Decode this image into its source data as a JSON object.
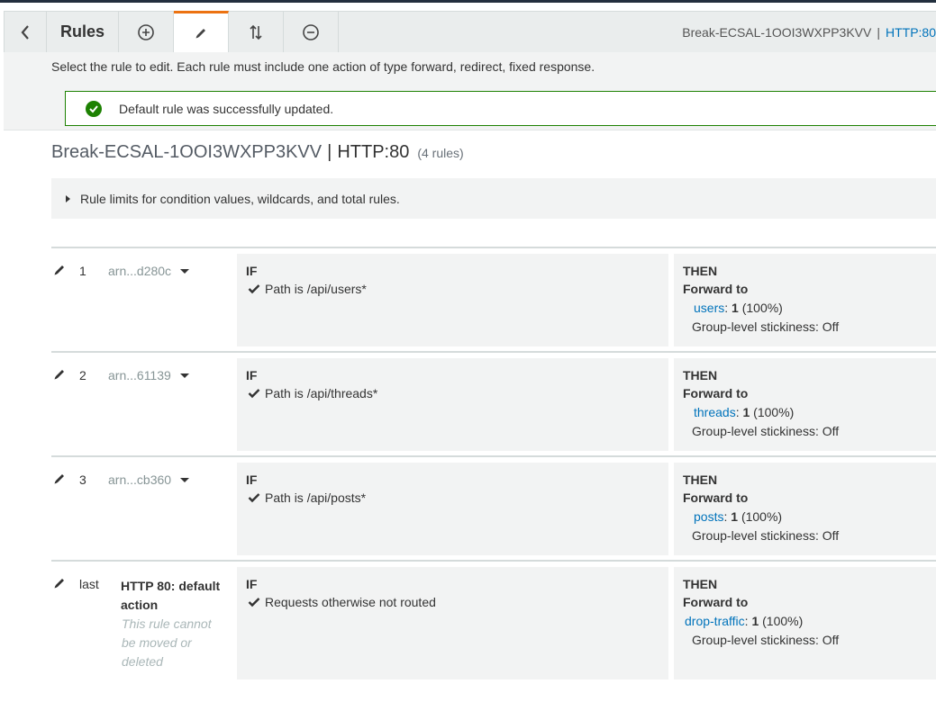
{
  "toolbar": {
    "title": "Rules",
    "lb_name": "Break-ECSAL-1OOI3WXPP3KVV",
    "separator": "|",
    "listener_link": "HTTP:80",
    "icons": [
      "back-chevron-icon",
      "add-circle-icon",
      "pencil-icon",
      "reorder-arrows-icon",
      "remove-circle-icon"
    ],
    "accent_color": "#ec7211"
  },
  "info": {
    "instructions": "Select the rule to edit. Each rule must include one action of type forward, redirect, fixed response.",
    "alert": "Default rule was successfully updated.",
    "alert_color": "#1d8102"
  },
  "heading": {
    "lb_name": "Break-ECSAL-1OOI3WXPP3KVV",
    "separator": "|",
    "listener": "HTTP:80",
    "rule_count": "(4 rules)"
  },
  "limits": {
    "text": "Rule limits for condition values, wildcards, and total rules."
  },
  "labels": {
    "if": "IF",
    "then": "THEN",
    "forward_to": "Forward to",
    "colon": ":"
  },
  "rules": [
    {
      "num": "1",
      "arn": "arn...d280c",
      "condition": "Path is /api/users*",
      "target": "users",
      "weight": "1",
      "percent": "(100%)",
      "stickiness": "Group-level stickiness: Off"
    },
    {
      "num": "2",
      "arn": "arn...61139",
      "condition": "Path is /api/threads*",
      "target": "threads",
      "weight": "1",
      "percent": "(100%)",
      "stickiness": "Group-level stickiness: Off"
    },
    {
      "num": "3",
      "arn": "arn...cb360",
      "condition": "Path is /api/posts*",
      "target": "posts",
      "weight": "1",
      "percent": "(100%)",
      "stickiness": "Group-level stickiness: Off"
    },
    {
      "num": "last",
      "default_title": "HTTP 80: default action",
      "default_note": "This rule cannot be moved or deleted",
      "condition": "Requests otherwise not routed",
      "target": "drop-traffic",
      "weight": "1",
      "percent": "(100%)",
      "stickiness": "Group-level stickiness: Off"
    }
  ]
}
